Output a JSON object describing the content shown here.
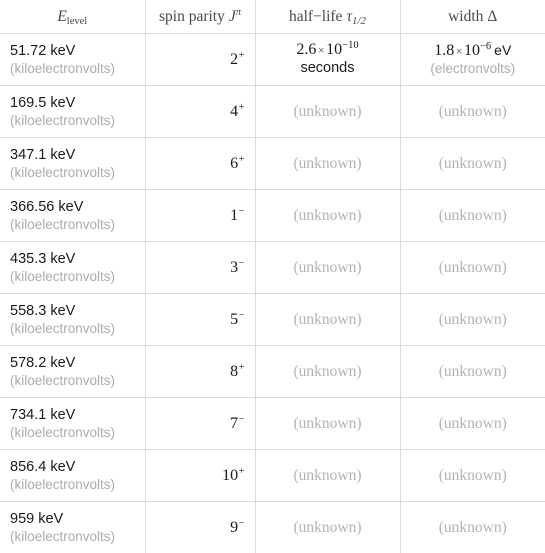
{
  "table": {
    "columns": [
      {
        "key": "energy",
        "label_plain": "E_level",
        "var": "E",
        "sub": "level",
        "align": "left"
      },
      {
        "key": "spin",
        "label_plain": "spin parity J^pi",
        "text": "spin parity",
        "var": "J",
        "sup": "π",
        "align": "right"
      },
      {
        "key": "halflife",
        "label_plain": "half-life tau_1/2",
        "text": "half−life",
        "var": "τ",
        "sub": "1/2",
        "align": "center"
      },
      {
        "key": "width",
        "label_plain": "width Δ",
        "text": "width",
        "var": "Δ",
        "align": "center"
      }
    ],
    "rows": [
      {
        "energy_value": "51.72 keV",
        "energy_unit": "(kiloelectronvolts)",
        "spin_value": "2",
        "spin_parity": "+",
        "halflife_mantissa": "2.6",
        "halflife_times": "×",
        "halflife_base": "10",
        "halflife_exp": "−10",
        "halflife_unit_inline": "",
        "halflife_second_line": "seconds",
        "halflife_second_line_gray": false,
        "width_mantissa": "1.8",
        "width_times": "×",
        "width_base": "10",
        "width_exp": "−6",
        "width_unit_inline": "eV",
        "width_second_line": "(electronvolts)",
        "width_second_line_gray": true
      },
      {
        "energy_value": "169.5 keV",
        "energy_unit": "(kiloelectronvolts)",
        "spin_value": "4",
        "spin_parity": "+",
        "halflife_unknown": "(unknown)",
        "width_unknown": "(unknown)"
      },
      {
        "energy_value": "347.1 keV",
        "energy_unit": "(kiloelectronvolts)",
        "spin_value": "6",
        "spin_parity": "+",
        "halflife_unknown": "(unknown)",
        "width_unknown": "(unknown)"
      },
      {
        "energy_value": "366.56 keV",
        "energy_unit": "(kiloelectronvolts)",
        "spin_value": "1",
        "spin_parity": "−",
        "halflife_unknown": "(unknown)",
        "width_unknown": "(unknown)"
      },
      {
        "energy_value": "435.3 keV",
        "energy_unit": "(kiloelectronvolts)",
        "spin_value": "3",
        "spin_parity": "−",
        "halflife_unknown": "(unknown)",
        "width_unknown": "(unknown)"
      },
      {
        "energy_value": "558.3 keV",
        "energy_unit": "(kiloelectronvolts)",
        "spin_value": "5",
        "spin_parity": "−",
        "halflife_unknown": "(unknown)",
        "width_unknown": "(unknown)"
      },
      {
        "energy_value": "578.2 keV",
        "energy_unit": "(kiloelectronvolts)",
        "spin_value": "8",
        "spin_parity": "+",
        "halflife_unknown": "(unknown)",
        "width_unknown": "(unknown)"
      },
      {
        "energy_value": "734.1 keV",
        "energy_unit": "(kiloelectronvolts)",
        "spin_value": "7",
        "spin_parity": "−",
        "halflife_unknown": "(unknown)",
        "width_unknown": "(unknown)"
      },
      {
        "energy_value": "856.4 keV",
        "energy_unit": "(kiloelectronvolts)",
        "spin_value": "10",
        "spin_parity": "+",
        "halflife_unknown": "(unknown)",
        "width_unknown": "(unknown)"
      },
      {
        "energy_value": "959 keV",
        "energy_unit": "(kiloelectronvolts)",
        "spin_value": "9",
        "spin_parity": "−",
        "halflife_unknown": "(unknown)",
        "width_unknown": "(unknown)"
      }
    ]
  },
  "colors": {
    "border": "#dcdcdc",
    "text_primary": "#1a1a1a",
    "text_header": "#4a4a4a",
    "text_muted": "#acacac",
    "text_unknown": "#b3b3b3",
    "background": "#ffffff"
  }
}
